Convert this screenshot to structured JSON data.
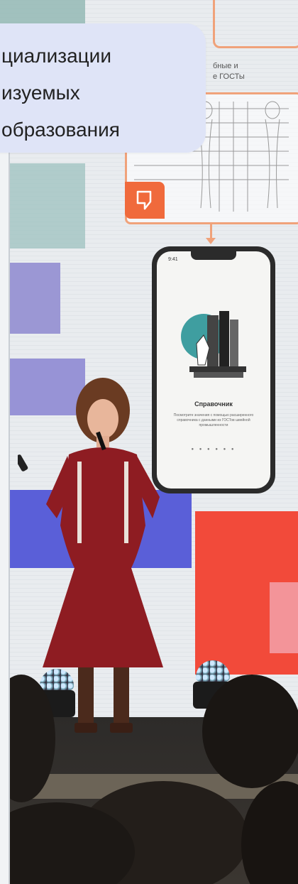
{
  "caption": {
    "lines": [
      "циализации",
      "изуемых",
      "образования"
    ]
  },
  "slide": {
    "diagram_caption_line1": "бные и",
    "diagram_caption_line2": "е ГОСТы",
    "phone": {
      "time": "9:41",
      "title": "Справочник",
      "text": "Посмотрите значения с помощью расширенного справочника с данными из ГОСТов швейной промышленности",
      "dots": "● ● ● ● ● ●"
    }
  },
  "colors": {
    "accent_orange": "#f0a27a",
    "stage_red": "#f24a3a",
    "stage_blue": "#5a5fd8",
    "stage_lavender": "#9b97d4",
    "dress_red": "#8e1c22"
  }
}
